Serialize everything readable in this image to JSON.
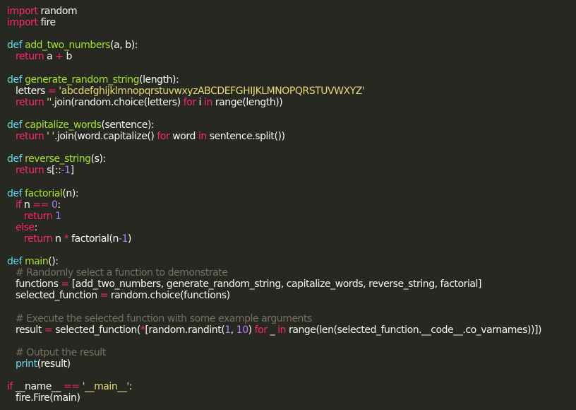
{
  "editor": {
    "lines": [
      [
        {
          "t": "import",
          "c": "k"
        },
        {
          "t": " random",
          "c": "p"
        }
      ],
      [
        {
          "t": "import",
          "c": "k"
        },
        {
          "t": " fire",
          "c": "p"
        }
      ],
      [],
      [
        {
          "t": "def ",
          "c": "d"
        },
        {
          "t": "add_two_numbers",
          "c": "f"
        },
        {
          "t": "(a, b):",
          "c": "p"
        }
      ],
      [
        {
          "t": "   ",
          "c": "p"
        },
        {
          "t": "return",
          "c": "k"
        },
        {
          "t": " a ",
          "c": "p"
        },
        {
          "t": "+",
          "c": "k"
        },
        {
          "t": " b",
          "c": "p"
        }
      ],
      [],
      [
        {
          "t": "def ",
          "c": "d"
        },
        {
          "t": "generate_random_string",
          "c": "f"
        },
        {
          "t": "(length):",
          "c": "p"
        }
      ],
      [
        {
          "t": "   letters ",
          "c": "p"
        },
        {
          "t": "=",
          "c": "k"
        },
        {
          "t": " ",
          "c": "p"
        },
        {
          "t": "'abcdefghijklmnopqrstuvwxyzABCDEFGHIJKLMNOPQRSTUVWXYZ'",
          "c": "s"
        }
      ],
      [
        {
          "t": "   ",
          "c": "p"
        },
        {
          "t": "return",
          "c": "k"
        },
        {
          "t": " ",
          "c": "p"
        },
        {
          "t": "''",
          "c": "s"
        },
        {
          "t": ".join(random.choice(letters) ",
          "c": "p"
        },
        {
          "t": "for",
          "c": "k"
        },
        {
          "t": " i ",
          "c": "p"
        },
        {
          "t": "in",
          "c": "k"
        },
        {
          "t": " range(length))",
          "c": "p"
        }
      ],
      [],
      [
        {
          "t": "def ",
          "c": "d"
        },
        {
          "t": "capitalize_words",
          "c": "f"
        },
        {
          "t": "(sentence):",
          "c": "p"
        }
      ],
      [
        {
          "t": "   ",
          "c": "p"
        },
        {
          "t": "return",
          "c": "k"
        },
        {
          "t": " ",
          "c": "p"
        },
        {
          "t": "' '",
          "c": "s"
        },
        {
          "t": ".join(word.capitalize() ",
          "c": "p"
        },
        {
          "t": "for",
          "c": "k"
        },
        {
          "t": " word ",
          "c": "p"
        },
        {
          "t": "in",
          "c": "k"
        },
        {
          "t": " sentence.split())",
          "c": "p"
        }
      ],
      [],
      [
        {
          "t": "def ",
          "c": "d"
        },
        {
          "t": "reverse_string",
          "c": "f"
        },
        {
          "t": "(s):",
          "c": "p"
        }
      ],
      [
        {
          "t": "   ",
          "c": "p"
        },
        {
          "t": "return",
          "c": "k"
        },
        {
          "t": " s[::",
          "c": "p"
        },
        {
          "t": "-1",
          "c": "n"
        },
        {
          "t": "]",
          "c": "p"
        }
      ],
      [],
      [
        {
          "t": "def ",
          "c": "d"
        },
        {
          "t": "factorial",
          "c": "f"
        },
        {
          "t": "(n):",
          "c": "p"
        }
      ],
      [
        {
          "t": "   ",
          "c": "p"
        },
        {
          "t": "if",
          "c": "k"
        },
        {
          "t": " n ",
          "c": "p"
        },
        {
          "t": "==",
          "c": "k"
        },
        {
          "t": " ",
          "c": "p"
        },
        {
          "t": "0",
          "c": "n"
        },
        {
          "t": ":",
          "c": "p"
        }
      ],
      [
        {
          "t": "      ",
          "c": "p"
        },
        {
          "t": "return",
          "c": "k"
        },
        {
          "t": " ",
          "c": "p"
        },
        {
          "t": "1",
          "c": "n"
        }
      ],
      [
        {
          "t": "   ",
          "c": "p"
        },
        {
          "t": "else",
          "c": "k"
        },
        {
          "t": ":",
          "c": "p"
        }
      ],
      [
        {
          "t": "      ",
          "c": "p"
        },
        {
          "t": "return",
          "c": "k"
        },
        {
          "t": " n ",
          "c": "p"
        },
        {
          "t": "*",
          "c": "k"
        },
        {
          "t": " factorial(n",
          "c": "p"
        },
        {
          "t": "-1",
          "c": "n"
        },
        {
          "t": ")",
          "c": "p"
        }
      ],
      [],
      [
        {
          "t": "def ",
          "c": "d"
        },
        {
          "t": "main",
          "c": "f"
        },
        {
          "t": "():",
          "c": "p"
        }
      ],
      [
        {
          "t": "   # Randomly select a function to demonstrate",
          "c": "c"
        }
      ],
      [
        {
          "t": "   functions ",
          "c": "p"
        },
        {
          "t": "=",
          "c": "k"
        },
        {
          "t": " [add_two_numbers, generate_random_string, capitalize_words, reverse_string, factorial]",
          "c": "p"
        }
      ],
      [
        {
          "t": "   selected_function ",
          "c": "p"
        },
        {
          "t": "=",
          "c": "k"
        },
        {
          "t": " random.choice(functions)",
          "c": "p"
        }
      ],
      [],
      [
        {
          "t": "   # Execute the selected function with some example arguments",
          "c": "c"
        }
      ],
      [
        {
          "t": "   result ",
          "c": "p"
        },
        {
          "t": "=",
          "c": "k"
        },
        {
          "t": " selected_function(",
          "c": "p"
        },
        {
          "t": "*",
          "c": "k"
        },
        {
          "t": "[random.randint(",
          "c": "p"
        },
        {
          "t": "1",
          "c": "n"
        },
        {
          "t": ", ",
          "c": "p"
        },
        {
          "t": "10",
          "c": "n"
        },
        {
          "t": ") ",
          "c": "p"
        },
        {
          "t": "for",
          "c": "k"
        },
        {
          "t": " _ ",
          "c": "p"
        },
        {
          "t": "in",
          "c": "k"
        },
        {
          "t": " range(len(selected_function.__code__.co_varnames))])",
          "c": "p"
        }
      ],
      [],
      [
        {
          "t": "   # Output the result",
          "c": "c"
        }
      ],
      [
        {
          "t": "   ",
          "c": "p"
        },
        {
          "t": "print",
          "c": "d"
        },
        {
          "t": "(result)",
          "c": "p"
        }
      ],
      [],
      [
        {
          "t": "if",
          "c": "k"
        },
        {
          "t": " __name__ ",
          "c": "p"
        },
        {
          "t": "==",
          "c": "k"
        },
        {
          "t": " ",
          "c": "p"
        },
        {
          "t": "'__main__'",
          "c": "s"
        },
        {
          "t": ":",
          "c": "p"
        }
      ],
      [
        {
          "t": "   fire.Fire(main)",
          "c": "p"
        }
      ]
    ],
    "colors": {
      "background": "#272822",
      "keyword": "#f92672",
      "def": "#66d9ef",
      "function": "#a6e22e",
      "string": "#e6db74",
      "number": "#ae81ff",
      "comment": "#75715e",
      "plain": "#f8f8f2"
    }
  }
}
